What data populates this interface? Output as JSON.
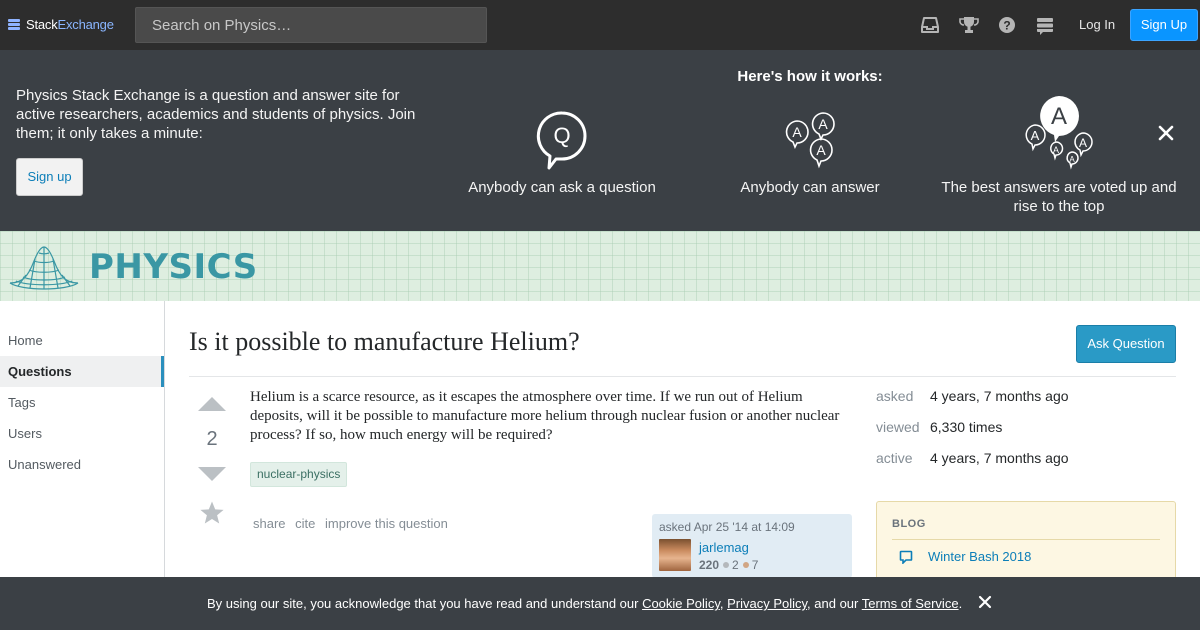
{
  "topbar": {
    "brand_part1": "Stack",
    "brand_part2": "Exchange",
    "search_placeholder": "Search on Physics…",
    "icons": [
      "inbox-icon",
      "achievements-icon",
      "help-icon",
      "site-switcher-icon"
    ],
    "login_label": "Log In",
    "signup_label": "Sign Up"
  },
  "hero": {
    "intro": "Physics Stack Exchange is a question and answer site for active researchers, academics and students of physics. Join them; it only takes a minute:",
    "signup_label": "Sign up",
    "how_title": "Here's how it works:",
    "steps": [
      {
        "label": "Anybody can ask a question",
        "icon": "question-bubble-icon",
        "glyph": "Q"
      },
      {
        "label": "Anybody can answer",
        "icon": "answer-bubbles-icon",
        "glyph": "A"
      },
      {
        "label": "The best answers are voted up and rise to the top",
        "icon": "voted-answer-icon",
        "glyph": "A"
      }
    ]
  },
  "site": {
    "name": "PHYSICS",
    "accent": "#3a97a4"
  },
  "nav": {
    "items": [
      {
        "label": "Home",
        "active": false
      },
      {
        "label": "Questions",
        "active": true
      },
      {
        "label": "Tags",
        "active": false
      },
      {
        "label": "Users",
        "active": false
      },
      {
        "label": "Unanswered",
        "active": false
      }
    ]
  },
  "question": {
    "title": "Is it possible to manufacture Helium?",
    "ask_label": "Ask Question",
    "votes": "2",
    "body": "Helium is a scarce resource, as it escapes the atmosphere over time. If we run out of Helium deposits, will it be possible to manufacture more helium through nuclear fusion or another nuclear process? If so, how much energy will be required?",
    "tags": [
      "nuclear-physics"
    ],
    "menu": [
      "share",
      "cite",
      "improve this question"
    ],
    "owner": {
      "asked": "asked Apr 25 '14 at 14:09",
      "name": "jarlemag",
      "rep": "220",
      "silver": "2",
      "bronze": "7"
    }
  },
  "stats": [
    {
      "label": "asked",
      "value": "4 years, 7 months ago"
    },
    {
      "label": "viewed",
      "value": "6,330 times"
    },
    {
      "label": "active",
      "value": "4 years, 7 months ago"
    }
  ],
  "blog": {
    "heading": "BLOG",
    "link": "Winter Bash 2018"
  },
  "cookie": {
    "prefix": "By using our site, you acknowledge that you have read and understand our ",
    "cookie_policy": "Cookie Policy",
    "sep1": ", ",
    "privacy_policy": "Privacy Policy",
    "sep2": ", and our ",
    "terms": "Terms of Service",
    "suffix": "."
  },
  "colors": {
    "topbar": "#2d2d2d",
    "hero": "#3b4045",
    "primary_button": "#0a95ff",
    "link": "#0c7eb8"
  }
}
